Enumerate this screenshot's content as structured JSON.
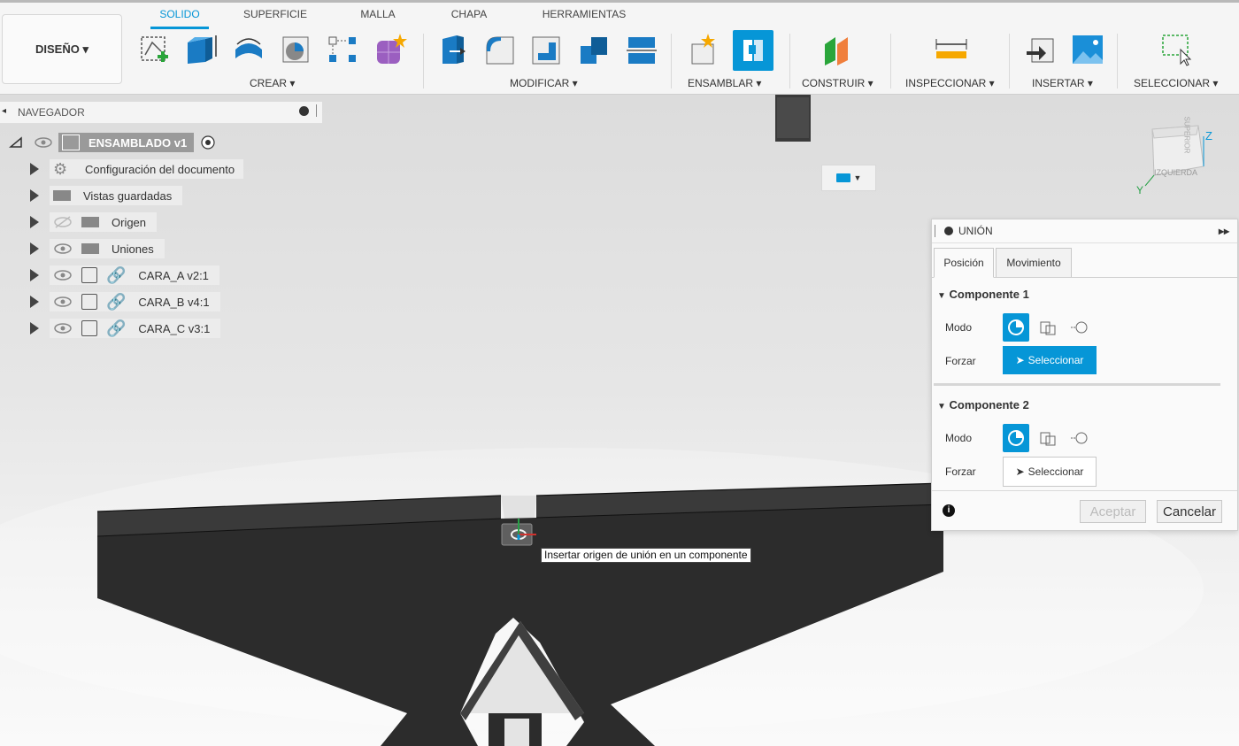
{
  "workspace": {
    "label": "DISEÑO ▾"
  },
  "tabs": [
    {
      "label": "SOLIDO",
      "active": true
    },
    {
      "label": "SUPERFICIE"
    },
    {
      "label": "MALLA"
    },
    {
      "label": "CHAPA"
    },
    {
      "label": "HERRAMIENTAS"
    }
  ],
  "groups": {
    "crear": "CREAR ▾",
    "modificar": "MODIFICAR ▾",
    "ensamblar": "ENSAMBLAR ▾",
    "construir": "CONSTRUIR ▾",
    "inspeccionar": "INSPECCIONAR ▾",
    "insertar": "INSERTAR ▾",
    "seleccionar": "SELECCIONAR ▾"
  },
  "navigator": {
    "title": "NAVEGADOR",
    "root": "ENSAMBLADO v1",
    "items": [
      {
        "label": "Configuración del documento"
      },
      {
        "label": "Vistas guardadas"
      },
      {
        "label": "Origen"
      },
      {
        "label": "Uniones"
      },
      {
        "label": "CARA_A v2:1"
      },
      {
        "label": "CARA_B v4:1"
      },
      {
        "label": "CARA_C v3:1"
      }
    ]
  },
  "viewcube": {
    "label": "IZQUIERDA",
    "top_label": "SUPERIOR",
    "axis_z": "Z",
    "axis_y": "Y"
  },
  "tooltip": "Insertar origen de unión en un componente",
  "joint_panel": {
    "title": "UNIÓN",
    "tabs": [
      "Posición",
      "Movimiento"
    ],
    "component1": {
      "title": "Componente 1",
      "mode_label": "Modo",
      "force_label": "Forzar",
      "select_label": "Seleccionar"
    },
    "component2": {
      "title": "Componente 2",
      "mode_label": "Modo",
      "force_label": "Forzar",
      "select_label": "Seleccionar"
    },
    "accept": "Aceptar",
    "cancel": "Cancelar"
  },
  "colors": {
    "accent": "#0696d7",
    "model": "#2b2b2b",
    "model_edge": "#4a4a4a"
  }
}
